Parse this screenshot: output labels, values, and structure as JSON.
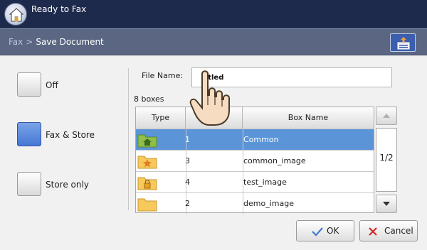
{
  "status": {
    "title": "Ready to Fax"
  },
  "breadcrumb": {
    "parent": "Fax",
    "separator": ">",
    "current": "Save Document"
  },
  "options": [
    {
      "label": "Off",
      "selected": false
    },
    {
      "label": "Fax & Store",
      "selected": true
    },
    {
      "label": "Store only",
      "selected": false
    }
  ],
  "file_name": {
    "label": "File Name:",
    "value": "Untitled",
    "visible_value": "titled"
  },
  "boxes": {
    "count_label": "8 boxes",
    "columns": [
      "Type",
      "No.",
      "Box Name"
    ],
    "rows": [
      {
        "icon": "home-folder-icon",
        "no": "1",
        "name": "Common",
        "selected": true
      },
      {
        "icon": "star-folder-icon",
        "no": "3",
        "name": "common_image",
        "selected": false
      },
      {
        "icon": "lock-folder-icon",
        "no": "4",
        "name": "test_image",
        "selected": false
      },
      {
        "icon": "folder-icon",
        "no": "2",
        "name": "demo_image",
        "selected": false
      }
    ],
    "page": "1/2"
  },
  "buttons": {
    "ok": "OK",
    "cancel": "Cancel"
  },
  "colors": {
    "selected_row": "#5b95d8",
    "status_bar": "#1e2a4c",
    "crumb_bar": "#5b6782",
    "accent": "#3b5fae"
  }
}
